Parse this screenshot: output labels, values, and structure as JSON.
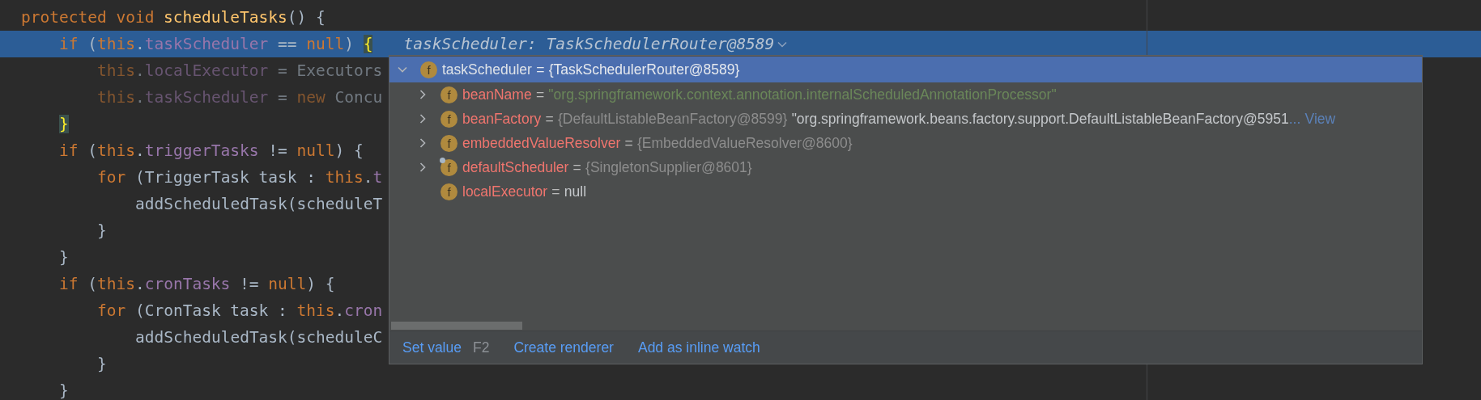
{
  "editor": {
    "lines": [
      {
        "selected": false,
        "dimmed": false,
        "tokens": [
          {
            "text": "protected ",
            "kind": "keyword"
          },
          {
            "text": "void ",
            "kind": "keyword"
          },
          {
            "text": "scheduleTasks",
            "kind": "method"
          },
          {
            "text": "() {",
            "kind": "plain"
          }
        ],
        "children": [
          {
            "selected": true,
            "dimmed": false,
            "hint": "taskScheduler: TaskSchedulerRouter@8589",
            "tokens": [
              {
                "text": "if",
                "kind": "keyword"
              },
              {
                "text": " (",
                "kind": "plain"
              },
              {
                "text": "this",
                "kind": "keyword"
              },
              {
                "text": ".",
                "kind": "plain"
              },
              {
                "text": "taskScheduler",
                "kind": "field"
              },
              {
                "text": " == ",
                "kind": "plain"
              },
              {
                "text": "null",
                "kind": "keyword"
              },
              {
                "text": ") ",
                "kind": "plain"
              },
              {
                "text": "{",
                "kind": "brace-match"
              }
            ],
            "children": [
              {
                "selected": false,
                "dimmed": true,
                "tokens": [
                  {
                    "text": "this",
                    "kind": "keyword"
                  },
                  {
                    "text": ".",
                    "kind": "plain"
                  },
                  {
                    "text": "localExecutor",
                    "kind": "field"
                  },
                  {
                    "text": " = Executors",
                    "kind": "plain"
                  }
                ]
              },
              {
                "selected": false,
                "dimmed": true,
                "tokens": [
                  {
                    "text": "this",
                    "kind": "keyword"
                  },
                  {
                    "text": ".",
                    "kind": "plain"
                  },
                  {
                    "text": "taskScheduler",
                    "kind": "field"
                  },
                  {
                    "text": " = ",
                    "kind": "plain"
                  },
                  {
                    "text": "new",
                    "kind": "keyword"
                  },
                  {
                    "text": " Concu",
                    "kind": "plain"
                  }
                ]
              }
            ]
          },
          {
            "selected": false,
            "dimmed": false,
            "tokens": [
              {
                "text": "}",
                "kind": "brace-match"
              }
            ]
          },
          {
            "selected": false,
            "dimmed": false,
            "tokens": [
              {
                "text": "if",
                "kind": "keyword"
              },
              {
                "text": " (",
                "kind": "plain"
              },
              {
                "text": "this",
                "kind": "keyword"
              },
              {
                "text": ".",
                "kind": "plain"
              },
              {
                "text": "triggerTasks",
                "kind": "field"
              },
              {
                "text": " != ",
                "kind": "plain"
              },
              {
                "text": "null",
                "kind": "keyword"
              },
              {
                "text": ") {",
                "kind": "plain"
              }
            ],
            "children": [
              {
                "selected": false,
                "dimmed": false,
                "tokens": [
                  {
                    "text": "for",
                    "kind": "keyword"
                  },
                  {
                    "text": " (TriggerTask task : ",
                    "kind": "plain"
                  },
                  {
                    "text": "this",
                    "kind": "keyword"
                  },
                  {
                    "text": ".",
                    "kind": "plain"
                  },
                  {
                    "text": "t",
                    "kind": "field"
                  }
                ],
                "children": [
                  {
                    "selected": false,
                    "dimmed": false,
                    "tokens": [
                      {
                        "text": "addScheduledTask(scheduleT",
                        "kind": "plain"
                      }
                    ]
                  }
                ]
              },
              {
                "selected": false,
                "dimmed": false,
                "tokens": [
                  {
                    "text": "}",
                    "kind": "plain"
                  }
                ]
              }
            ]
          },
          {
            "selected": false,
            "dimmed": false,
            "tokens": [
              {
                "text": "}",
                "kind": "plain"
              }
            ]
          },
          {
            "selected": false,
            "dimmed": false,
            "tokens": [
              {
                "text": "if",
                "kind": "keyword"
              },
              {
                "text": " (",
                "kind": "plain"
              },
              {
                "text": "this",
                "kind": "keyword"
              },
              {
                "text": ".",
                "kind": "plain"
              },
              {
                "text": "cronTasks",
                "kind": "field"
              },
              {
                "text": " != ",
                "kind": "plain"
              },
              {
                "text": "null",
                "kind": "keyword"
              },
              {
                "text": ") {",
                "kind": "plain"
              }
            ],
            "children": [
              {
                "selected": false,
                "dimmed": false,
                "tokens": [
                  {
                    "text": "for",
                    "kind": "keyword"
                  },
                  {
                    "text": " (CronTask task : ",
                    "kind": "plain"
                  },
                  {
                    "text": "this",
                    "kind": "keyword"
                  },
                  {
                    "text": ".",
                    "kind": "plain"
                  },
                  {
                    "text": "cron",
                    "kind": "field"
                  }
                ],
                "children": [
                  {
                    "selected": false,
                    "dimmed": false,
                    "tokens": [
                      {
                        "text": "addScheduledTask(scheduleC",
                        "kind": "plain"
                      }
                    ]
                  }
                ]
              },
              {
                "selected": false,
                "dimmed": false,
                "tokens": [
                  {
                    "text": "}",
                    "kind": "plain"
                  }
                ]
              }
            ]
          },
          {
            "selected": false,
            "dimmed": false,
            "tokens": [
              {
                "text": "}",
                "kind": "plain"
              }
            ]
          }
        ]
      }
    ]
  },
  "popup": {
    "tree": [
      {
        "icon": "f",
        "marker": false,
        "expandable": true,
        "expanded": true,
        "selected": true,
        "segments": [
          {
            "text": "taskScheduler",
            "kind": "root-name"
          },
          {
            "text": "=",
            "kind": "operator"
          },
          {
            "text": "{TaskSchedulerRouter@8589}",
            "kind": "plain"
          }
        ],
        "children": [
          {
            "icon": "f",
            "marker": false,
            "expandable": true,
            "expanded": false,
            "selected": false,
            "segments": [
              {
                "text": "beanName",
                "kind": "name"
              },
              {
                "text": "=",
                "kind": "operator"
              },
              {
                "text": "\"org.springframework.context.annotation.internalScheduledAnnotationProcessor\"",
                "kind": "string"
              }
            ]
          },
          {
            "icon": "f",
            "marker": false,
            "expandable": true,
            "expanded": false,
            "selected": false,
            "segments": [
              {
                "text": "beanFactory",
                "kind": "name"
              },
              {
                "text": "=",
                "kind": "operator"
              },
              {
                "text": "{DefaultListableBeanFactory@8599}",
                "kind": "ref"
              },
              {
                "text": "\"org.springframework.beans.factory.support.DefaultListableBeanFactory@5951",
                "kind": "plain"
              },
              {
                "text": "...",
                "kind": "ellipsis"
              },
              {
                "text": "View",
                "kind": "link"
              }
            ]
          },
          {
            "icon": "f",
            "marker": false,
            "expandable": true,
            "expanded": false,
            "selected": false,
            "segments": [
              {
                "text": "embeddedValueResolver",
                "kind": "name"
              },
              {
                "text": "=",
                "kind": "operator"
              },
              {
                "text": "{EmbeddedValueResolver@8600}",
                "kind": "ref"
              }
            ]
          },
          {
            "icon": "f",
            "marker": true,
            "expandable": true,
            "expanded": false,
            "selected": false,
            "segments": [
              {
                "text": "defaultScheduler",
                "kind": "name"
              },
              {
                "text": "=",
                "kind": "operator"
              },
              {
                "text": "{SingletonSupplier@8601}",
                "kind": "ref"
              }
            ]
          },
          {
            "icon": "f",
            "marker": false,
            "expandable": false,
            "selected": false,
            "segments": [
              {
                "text": "localExecutor",
                "kind": "name"
              },
              {
                "text": "=",
                "kind": "operator"
              },
              {
                "text": "null",
                "kind": "plain"
              }
            ]
          }
        ]
      }
    ],
    "actions": [
      {
        "label": "Set value",
        "shortcut": "F2"
      },
      {
        "label": "Create renderer"
      },
      {
        "label": "Add as inline watch"
      }
    ]
  }
}
